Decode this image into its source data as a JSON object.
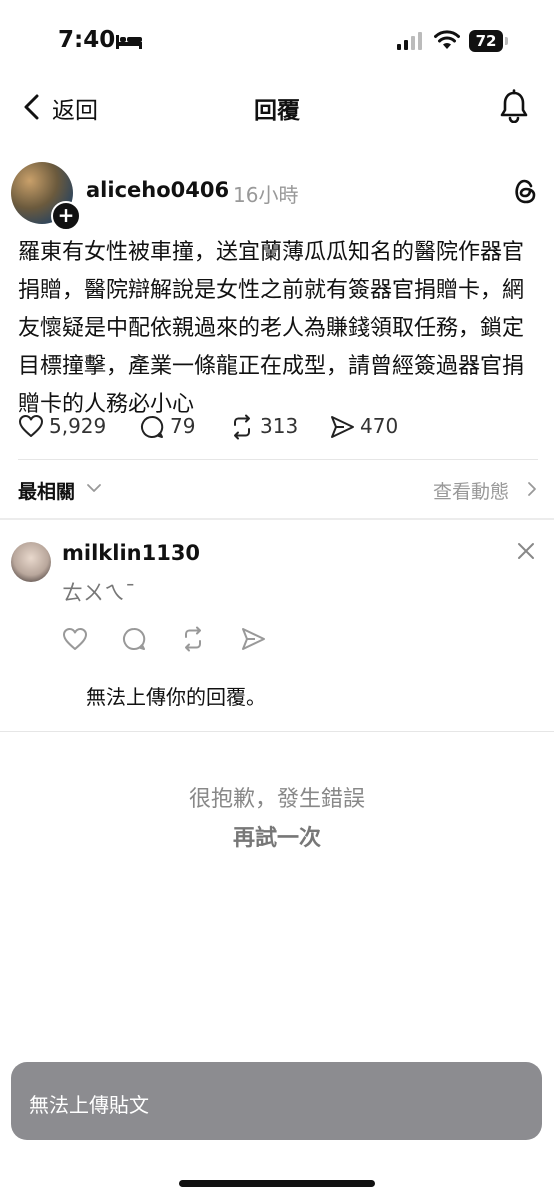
{
  "status_bar": {
    "time": "7:40",
    "battery": "72",
    "icons": [
      "bed-icon",
      "signal-icon",
      "wifi-icon",
      "battery-icon"
    ]
  },
  "nav": {
    "back_label": "返回",
    "title": "回覆",
    "right_icon": "bell-icon"
  },
  "post": {
    "username": "aliceho0406",
    "time": "16小時",
    "body": "羅東有女性被車撞，送宜蘭薄瓜瓜知名的醫院作器官捐贈，醫院辯解說是女性之前就有簽器官捐贈卡，網友懷疑是中配依親過來的老人為賺錢領取任務，鎖定目標撞擊，產業一條龍正在成型，請曾經簽過器官捐贈卡的人務必小心",
    "likes": "5,929",
    "comments": "79",
    "reposts": "313",
    "shares": "470"
  },
  "sort": {
    "label": "最相關",
    "view_activity": "查看動態"
  },
  "reply": {
    "username": "milklin1130",
    "text": "ㄊㄨㄟˉ",
    "status": "無法上傳你的回覆。"
  },
  "error": {
    "message": "很抱歉，發生錯誤",
    "retry": "再試一次"
  },
  "toast": {
    "message": "無法上傳貼文"
  }
}
